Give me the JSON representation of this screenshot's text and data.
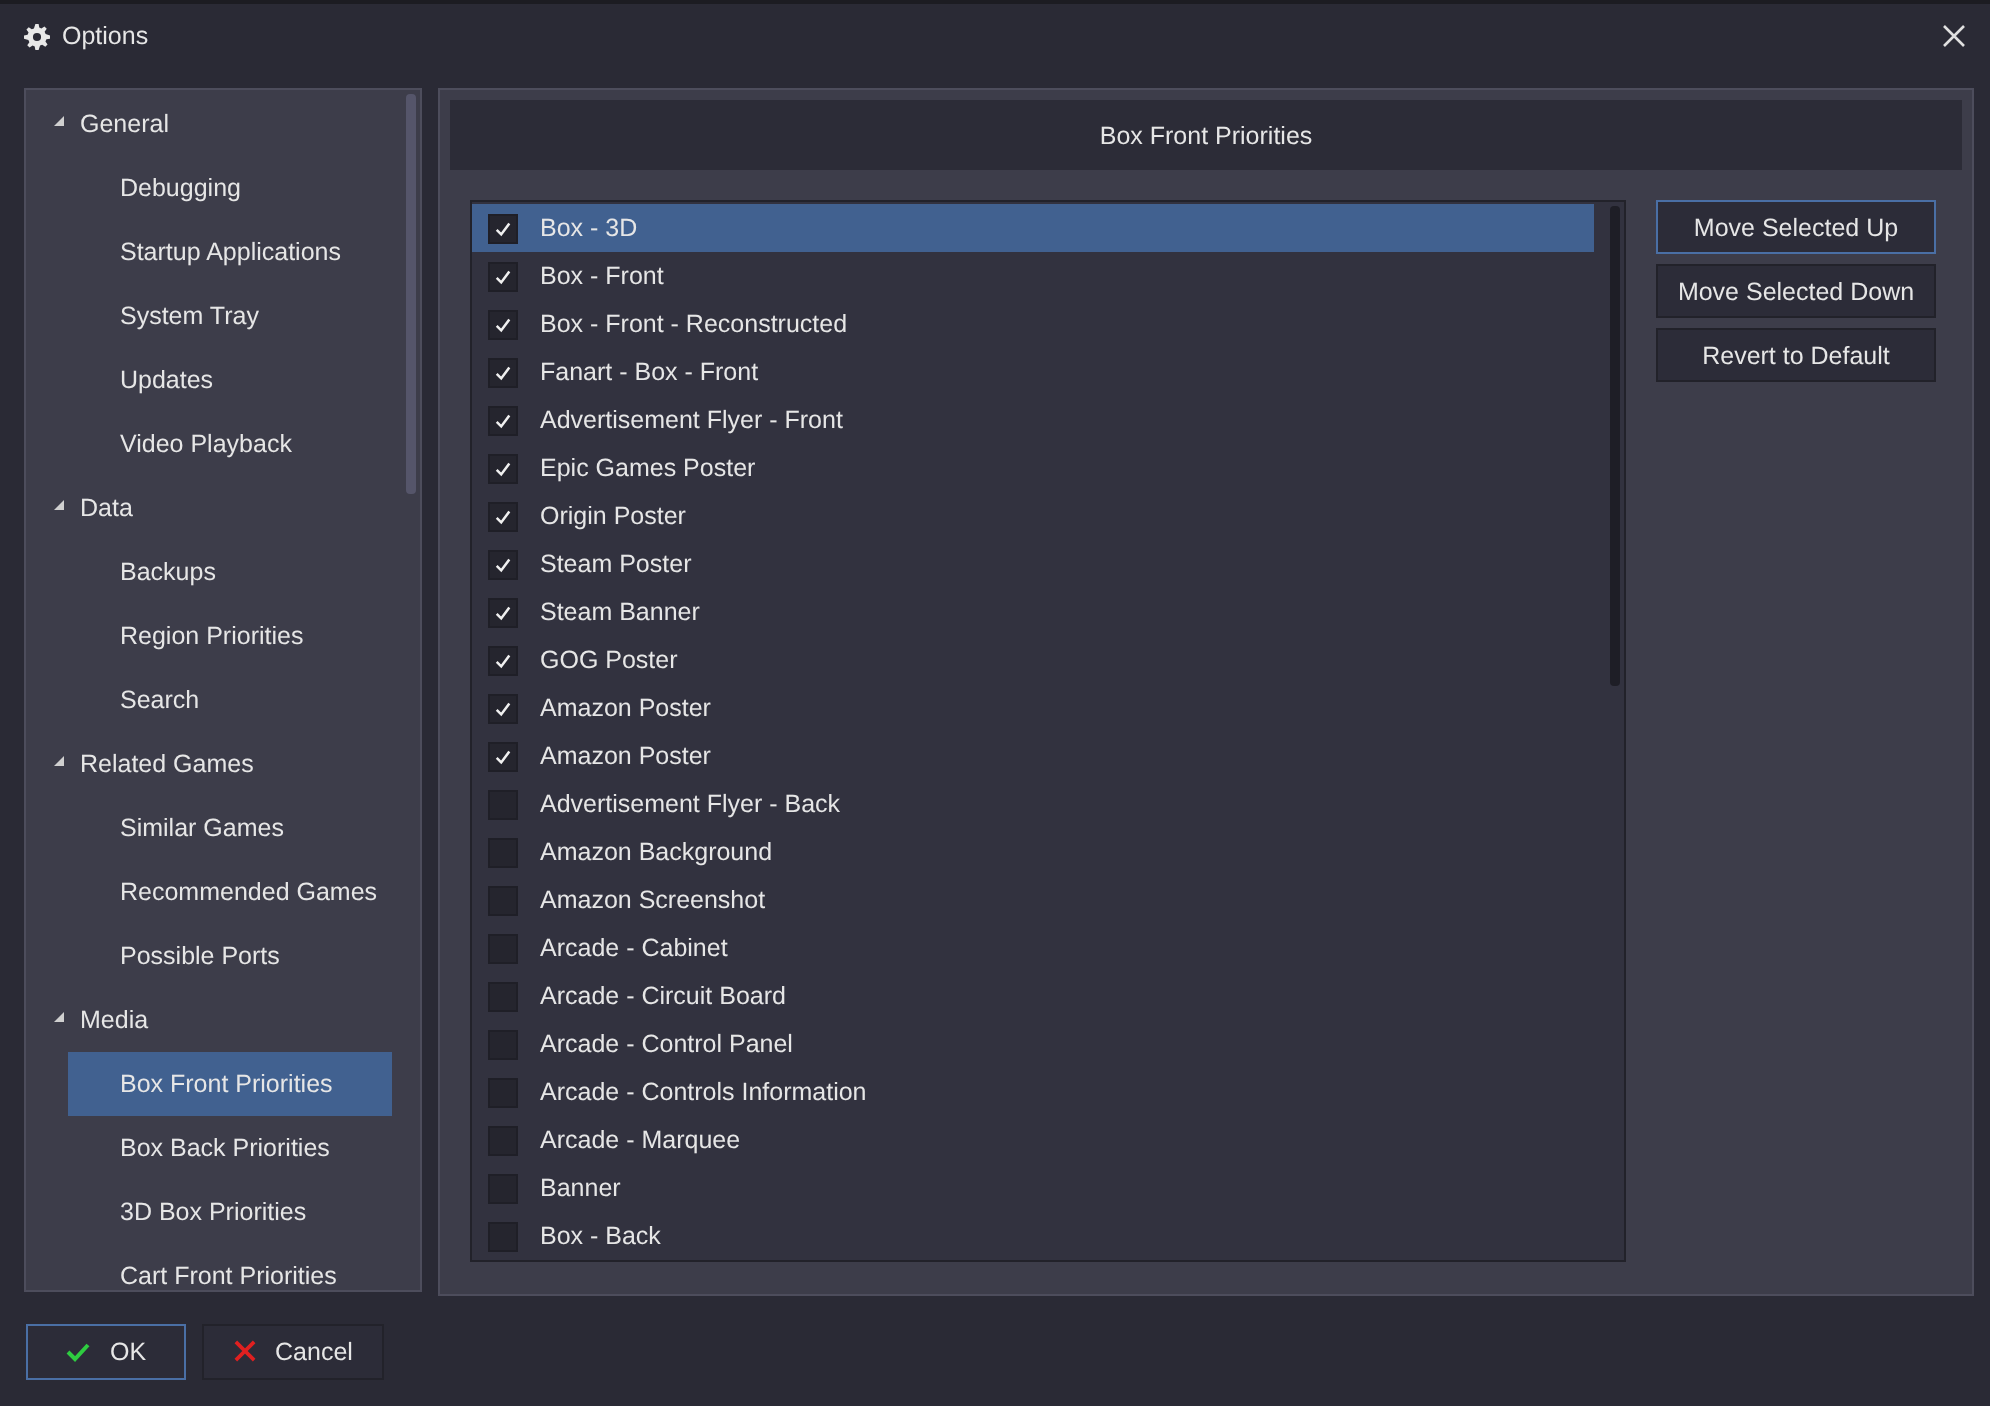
{
  "window": {
    "title": "Options"
  },
  "sidebar": {
    "items": [
      {
        "label": "General",
        "expanded": true,
        "selected": false,
        "children": [
          {
            "label": "Debugging",
            "selected": false
          },
          {
            "label": "Startup Applications",
            "selected": false
          },
          {
            "label": "System Tray",
            "selected": false
          },
          {
            "label": "Updates",
            "selected": false
          },
          {
            "label": "Video Playback",
            "selected": false
          }
        ]
      },
      {
        "label": "Data",
        "expanded": true,
        "selected": false,
        "children": [
          {
            "label": "Backups",
            "selected": false
          },
          {
            "label": "Region Priorities",
            "selected": false
          },
          {
            "label": "Search",
            "selected": false
          }
        ]
      },
      {
        "label": "Related Games",
        "expanded": true,
        "selected": false,
        "children": [
          {
            "label": "Similar Games",
            "selected": false
          },
          {
            "label": "Recommended Games",
            "selected": false
          },
          {
            "label": "Possible Ports",
            "selected": false
          }
        ]
      },
      {
        "label": "Media",
        "expanded": true,
        "selected": false,
        "children": [
          {
            "label": "Box Front Priorities",
            "selected": true
          },
          {
            "label": "Box Back Priorities",
            "selected": false
          },
          {
            "label": "3D Box Priorities",
            "selected": false
          },
          {
            "label": "Cart Front Priorities",
            "selected": false
          }
        ]
      }
    ]
  },
  "panel": {
    "title": "Box Front Priorities",
    "items": [
      {
        "label": "Box - 3D",
        "checked": true,
        "selected": true
      },
      {
        "label": "Box - Front",
        "checked": true,
        "selected": false
      },
      {
        "label": "Box - Front - Reconstructed",
        "checked": true,
        "selected": false
      },
      {
        "label": "Fanart - Box - Front",
        "checked": true,
        "selected": false
      },
      {
        "label": "Advertisement Flyer - Front",
        "checked": true,
        "selected": false
      },
      {
        "label": "Epic Games Poster",
        "checked": true,
        "selected": false
      },
      {
        "label": "Origin Poster",
        "checked": true,
        "selected": false
      },
      {
        "label": "Steam Poster",
        "checked": true,
        "selected": false
      },
      {
        "label": "Steam Banner",
        "checked": true,
        "selected": false
      },
      {
        "label": "GOG Poster",
        "checked": true,
        "selected": false
      },
      {
        "label": "Amazon Poster",
        "checked": true,
        "selected": false
      },
      {
        "label": "Amazon Poster",
        "checked": true,
        "selected": false
      },
      {
        "label": "Advertisement Flyer - Back",
        "checked": false,
        "selected": false
      },
      {
        "label": "Amazon Background",
        "checked": false,
        "selected": false
      },
      {
        "label": "Amazon Screenshot",
        "checked": false,
        "selected": false
      },
      {
        "label": "Arcade - Cabinet",
        "checked": false,
        "selected": false
      },
      {
        "label": "Arcade - Circuit Board",
        "checked": false,
        "selected": false
      },
      {
        "label": "Arcade - Control Panel",
        "checked": false,
        "selected": false
      },
      {
        "label": "Arcade - Controls Information",
        "checked": false,
        "selected": false
      },
      {
        "label": "Arcade - Marquee",
        "checked": false,
        "selected": false
      },
      {
        "label": "Banner",
        "checked": false,
        "selected": false
      },
      {
        "label": "Box - Back",
        "checked": false,
        "selected": false
      }
    ],
    "buttons": [
      {
        "label": "Move Selected Up",
        "focused": true
      },
      {
        "label": "Move Selected Down",
        "focused": false
      },
      {
        "label": "Revert to Default",
        "focused": false
      }
    ]
  },
  "footer": {
    "buttons": [
      {
        "label": "OK",
        "kind": "ok",
        "focused": true
      },
      {
        "label": "Cancel",
        "kind": "cancel",
        "focused": false
      }
    ]
  }
}
